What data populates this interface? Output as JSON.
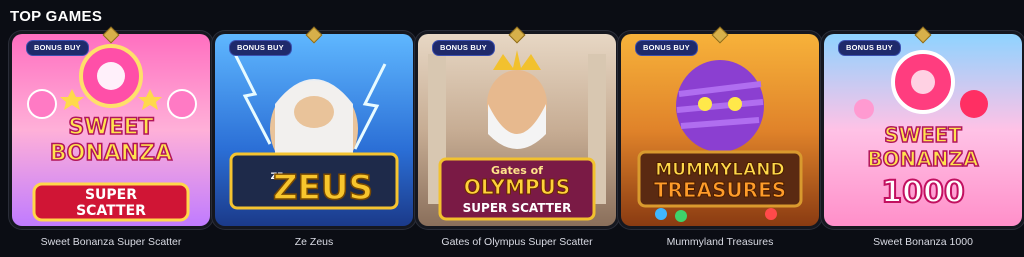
{
  "section": {
    "title": "TOP GAMES"
  },
  "games": [
    {
      "name": "Sweet Bonanza Super Scatter",
      "badge": "BONUS BUY",
      "logo": [
        "SWEET",
        "BONANZA",
        "SUPER",
        "SCATTER"
      ]
    },
    {
      "name": "Ze Zeus",
      "badge": "BONUS BUY",
      "logo": [
        "ZE",
        "ZEUS"
      ]
    },
    {
      "name": "Gates of Olympus Super Scatter",
      "badge": "BONUS BUY",
      "logo": [
        "Gates of",
        "OLYMPUS",
        "SUPER SCATTER"
      ]
    },
    {
      "name": "Mummyland Treasures",
      "badge": "BONUS BUY",
      "logo": [
        "MUMMYLAND",
        "TREASURES"
      ]
    },
    {
      "name": "Sweet Bonanza 1000",
      "badge": "BONUS BUY",
      "logo": [
        "SWEET",
        "BONANZA",
        "1000"
      ]
    }
  ],
  "colors": {
    "background": "#0b0d14",
    "badge": "#1f2a6b",
    "accent": "#d7b04a"
  }
}
